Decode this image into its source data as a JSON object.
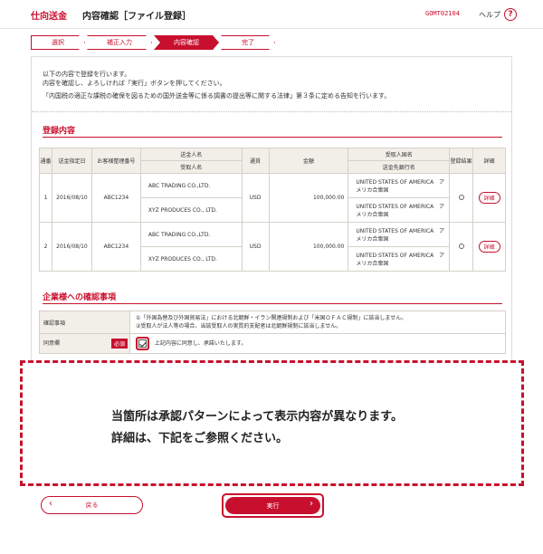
{
  "header": {
    "service": "仕向送金",
    "title": "内容確認［ファイル登録］",
    "screen_code": "GOMT02104",
    "help_label": "ヘルプ",
    "help_icon": "?"
  },
  "steps": [
    {
      "label": "選択",
      "width": 60
    },
    {
      "label": "補正入力",
      "width": 72
    },
    {
      "label": "内容確認",
      "width": 72
    },
    {
      "label": "完了",
      "width": 60
    }
  ],
  "intro": {
    "line1": "以下の内容で登録を行います。",
    "line2": "内容を確認し、よろしければ「実行」ボタンを押してください。",
    "law": "「内国税の適正な課税の確保を図るための国外送金等に係る調書の提出等に関する法律」第３条に定める告知を行います。"
  },
  "registration": {
    "title": "登録内容",
    "headers": {
      "no": "通番",
      "date": "送金指定日",
      "ref": "お客様整理番号",
      "sender_name": "送金人名",
      "receiver_name": "受取人名",
      "currency": "通貨",
      "amount": "金額",
      "beneficiary_name": "受取人国名",
      "beneficiary_bank": "送金先銀行名",
      "result": "登録結果",
      "detail": "詳細"
    },
    "rows": [
      {
        "no": "1",
        "date": "2016/08/10",
        "ref": "ABC1234",
        "sender": "ABC TRADING CO.,LTD.",
        "receiver": "XYZ PRODUCES CO., LTD.",
        "currency": "USD",
        "amount": "100,000.00",
        "country": "UNITED STATES OF AMERICA　アメリカ合衆国",
        "bank": "UNITED STATES OF AMERICA　アメリカ合衆国",
        "detail": "詳細"
      },
      {
        "no": "2",
        "date": "2016/08/10",
        "ref": "ABC1234",
        "sender": "ABC TRADING CO.,LTD.",
        "receiver": "XYZ PRODUCES CO., LTD.",
        "currency": "USD",
        "amount": "100,000.00",
        "country": "UNITED STATES OF AMERICA　アメリカ合衆国",
        "bank": "UNITED STATES OF AMERICA　アメリカ合衆国",
        "detail": "詳細"
      }
    ]
  },
  "confirm": {
    "title": "企業様への確認事項",
    "items_label": "確認事項",
    "item1": "①「外国為替及び外国貿易法」における北朝鮮・イラン関連規制および「米国ＯＦＡＣ規制」に該当しません。",
    "item2": "②受取人が法人等の場合、当該受取人の実質的支配者は北朝鮮規制に該当しません。",
    "agree_label": "同意欄",
    "required": "必須",
    "agree_text": "上記内容に同意し、承諾いたします。"
  },
  "notice": {
    "line1": "当箇所は承認パターンによって表示内容が異なります。",
    "line2": "詳細は、下記をご参照ください。"
  },
  "buttons": {
    "back": "戻る",
    "execute": "実行"
  },
  "colors": {
    "accent": "#c8102e"
  }
}
